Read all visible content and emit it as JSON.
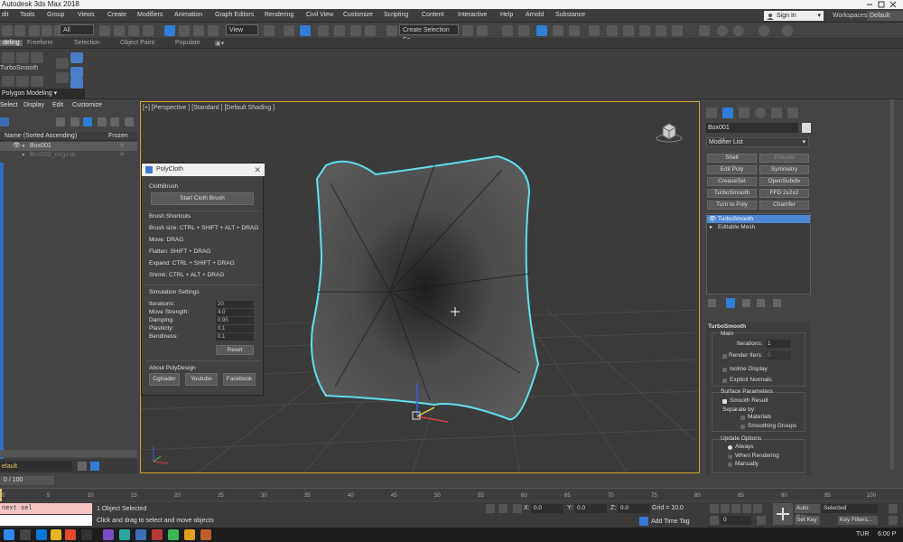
{
  "window": {
    "title": "Autodesk 3ds Max 2018"
  },
  "menu": [
    "dit",
    "Tools",
    "Group",
    "Views",
    "Create",
    "Modifiers",
    "Animation",
    "Graph Editors",
    "Rendering",
    "Civil View",
    "Customize",
    "Scripting",
    "Content",
    "Interactive",
    "Help",
    "Arnold",
    "Substance"
  ],
  "account": {
    "sign_in": "Sign In",
    "workspaces_label": "Workspaces:",
    "workspace": "Default"
  },
  "toolbar": {
    "filter": "All",
    "ref_coord": "View",
    "selection_set": "Create Selection Se"
  },
  "ribbon": {
    "tabs": [
      "deling",
      "Freeform",
      "Selection",
      "Object Paint",
      "Populate"
    ],
    "turbosmooth_label": "TurboSmooth",
    "polygon_modeling": "Polygon Modeling"
  },
  "scene": {
    "menu": [
      "Select",
      "Display",
      "Edit",
      "Customize"
    ],
    "col_name": "Name (Sorted Ascending)",
    "col_frozen": "Frozen",
    "rows": [
      {
        "name": "Box001",
        "selected": true
      },
      {
        "name": "Box002_original",
        "selected": false
      }
    ],
    "layer": "efault"
  },
  "viewport": {
    "label": "[+] [Perspective ] [Standard ] [Default Shading ]"
  },
  "polycloth": {
    "title": "PolyCloth",
    "cloth_brush": "ClothBrush",
    "start_button": "Start Cloth Brush",
    "shortcuts_title": "Brush Shortcuts",
    "shortcuts": [
      "Brush size: CTRL + SHIFT + ALT + DRAG",
      "Move: DRAG",
      "Flatten: SHIFT + DRAG",
      "Expand: CTRL + SHIFT + DRAG",
      "Shrink: CTRL + ALT + DRAG"
    ],
    "sim_title": "Simulation Settings",
    "params": [
      {
        "label": "Iterations:",
        "value": "20"
      },
      {
        "label": "Move Strength:",
        "value": "4.0"
      },
      {
        "label": "Damping:",
        "value": "0.95"
      },
      {
        "label": "Plasticity:",
        "value": "0.1"
      },
      {
        "label": "Bendiness:",
        "value": "0.1"
      }
    ],
    "reset": "Reset",
    "about_title": "About PolyDesign",
    "links": [
      "Cgtrader",
      "Youtube",
      "Facebook"
    ]
  },
  "command": {
    "object_name": "Box001",
    "modifier_list": "Modifier List",
    "mod_buttons": [
      {
        "label": "Shell",
        "enabled": true
      },
      {
        "label": "Extrude",
        "enabled": false
      },
      {
        "label": "Edit Poly",
        "enabled": true
      },
      {
        "label": "Symmetry",
        "enabled": true
      },
      {
        "label": "CreaseSet",
        "enabled": true
      },
      {
        "label": "OpenSubdiv",
        "enabled": true
      },
      {
        "label": "TurboSmooth",
        "enabled": true
      },
      {
        "label": "FFD 2x2x2",
        "enabled": true
      },
      {
        "label": "Turn to Poly",
        "enabled": true
      },
      {
        "label": "Chamfer",
        "enabled": true
      }
    ],
    "stack": [
      {
        "label": "TurboSmooth",
        "selected": true
      },
      {
        "label": "Editable Mesh",
        "selected": false
      }
    ],
    "turbosmooth": {
      "title": "TurboSmooth",
      "main": "Main",
      "iterations_label": "Iterations:",
      "iterations": "1",
      "render_iters_label": "Render Iters:",
      "render_iters": "0",
      "isoline": "Isoline Display",
      "explicit_normals": "Explicit Normals",
      "surface_params": "Surface Parameters",
      "smooth_result": "Smooth Result",
      "separate_by": "Separate by:",
      "materials": "Materials",
      "smoothing_groups": "Smoothing Groups",
      "update_options": "Update Options",
      "always": "Always",
      "when_rendering": "When Rendering",
      "manually": "Manually"
    }
  },
  "timeline": {
    "frame": "0 / 100",
    "ticks": [
      "0",
      "5",
      "10",
      "15",
      "20",
      "25",
      "30",
      "35",
      "40",
      "45",
      "50",
      "55",
      "60",
      "65",
      "70",
      "75",
      "80",
      "85",
      "90",
      "95",
      "100"
    ]
  },
  "status": {
    "maxscript": "next sel",
    "selected": "1 Object Selected",
    "prompt": "Click and drag to select and move objects",
    "x_label": "X:",
    "x": "0.0",
    "y_label": "Y:",
    "y": "0.0",
    "z_label": "Z:",
    "z": "0.0",
    "grid": "Grid = 10.0",
    "add_time_tag": "Add Time Tag",
    "frame_field": "0",
    "auto_key": "Auto Key",
    "set_key": "Set Key",
    "selected_dd": "Selected",
    "key_filters": "Key Filters..."
  },
  "taskbar": {
    "lang": "TUR",
    "clock": "6:00 P"
  },
  "colors": {
    "accent": "#2f7fd8",
    "viewport_border": "#d4a02c",
    "selection_outline": "#5fe0f0"
  }
}
